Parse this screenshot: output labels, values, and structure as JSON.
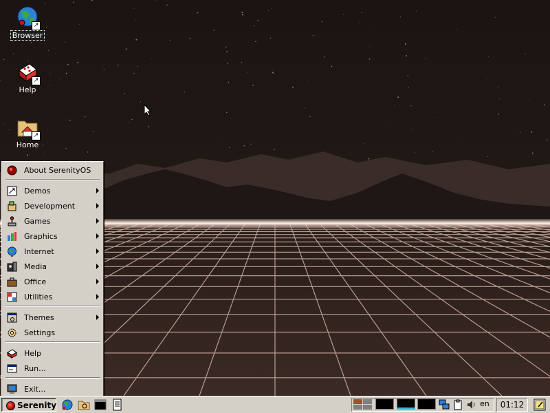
{
  "desktop": {
    "icons": [
      {
        "label": "Browser",
        "icon": "globe-icon"
      },
      {
        "label": "Help",
        "icon": "help-book-icon"
      },
      {
        "label": "Home",
        "icon": "home-folder-icon"
      }
    ]
  },
  "start_menu": {
    "items": [
      {
        "label": "About SerenityOS",
        "icon": "serenity-logo-icon",
        "submenu": false
      },
      {
        "label": "Demos",
        "icon": "demos-icon",
        "submenu": true
      },
      {
        "label": "Development",
        "icon": "development-icon",
        "submenu": true
      },
      {
        "label": "Games",
        "icon": "joystick-icon",
        "submenu": true
      },
      {
        "label": "Graphics",
        "icon": "graphics-icon",
        "submenu": true
      },
      {
        "label": "Internet",
        "icon": "globe-icon",
        "submenu": true
      },
      {
        "label": "Media",
        "icon": "media-icon",
        "submenu": true
      },
      {
        "label": "Office",
        "icon": "briefcase-icon",
        "submenu": true
      },
      {
        "label": "Utilities",
        "icon": "utilities-icon",
        "submenu": true
      },
      {
        "label": "Themes",
        "icon": "themes-icon",
        "submenu": true
      },
      {
        "label": "Settings",
        "icon": "gear-icon",
        "submenu": false
      },
      {
        "label": "Help",
        "icon": "help-book-icon",
        "submenu": false
      },
      {
        "label": "Run...",
        "icon": "run-icon",
        "submenu": false
      },
      {
        "label": "Exit...",
        "icon": "exit-icon",
        "submenu": false
      }
    ]
  },
  "taskbar": {
    "start_label": "Serenity",
    "quick_launch": [
      "browser-icon",
      "file-manager-icon",
      "terminal-icon",
      "text-editor-icon"
    ],
    "language": "en",
    "clock": "01:12"
  },
  "colors": {
    "chrome": "#d4d0c8",
    "grid_line": "#e8c7b8",
    "accent_red": "#9b0000"
  }
}
